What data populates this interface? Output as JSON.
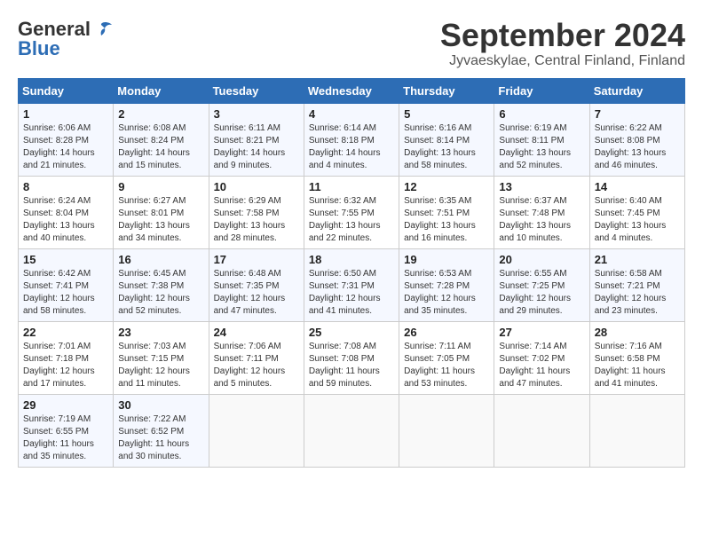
{
  "header": {
    "logo_general": "General",
    "logo_blue": "Blue",
    "title": "September 2024",
    "subtitle": "Jyvaeskylae, Central Finland, Finland"
  },
  "weekdays": [
    "Sunday",
    "Monday",
    "Tuesday",
    "Wednesday",
    "Thursday",
    "Friday",
    "Saturday"
  ],
  "weeks": [
    [
      {
        "day": "1",
        "sunrise": "Sunrise: 6:06 AM",
        "sunset": "Sunset: 8:28 PM",
        "daylight": "Daylight: 14 hours and 21 minutes."
      },
      {
        "day": "2",
        "sunrise": "Sunrise: 6:08 AM",
        "sunset": "Sunset: 8:24 PM",
        "daylight": "Daylight: 14 hours and 15 minutes."
      },
      {
        "day": "3",
        "sunrise": "Sunrise: 6:11 AM",
        "sunset": "Sunset: 8:21 PM",
        "daylight": "Daylight: 14 hours and 9 minutes."
      },
      {
        "day": "4",
        "sunrise": "Sunrise: 6:14 AM",
        "sunset": "Sunset: 8:18 PM",
        "daylight": "Daylight: 14 hours and 4 minutes."
      },
      {
        "day": "5",
        "sunrise": "Sunrise: 6:16 AM",
        "sunset": "Sunset: 8:14 PM",
        "daylight": "Daylight: 13 hours and 58 minutes."
      },
      {
        "day": "6",
        "sunrise": "Sunrise: 6:19 AM",
        "sunset": "Sunset: 8:11 PM",
        "daylight": "Daylight: 13 hours and 52 minutes."
      },
      {
        "day": "7",
        "sunrise": "Sunrise: 6:22 AM",
        "sunset": "Sunset: 8:08 PM",
        "daylight": "Daylight: 13 hours and 46 minutes."
      }
    ],
    [
      {
        "day": "8",
        "sunrise": "Sunrise: 6:24 AM",
        "sunset": "Sunset: 8:04 PM",
        "daylight": "Daylight: 13 hours and 40 minutes."
      },
      {
        "day": "9",
        "sunrise": "Sunrise: 6:27 AM",
        "sunset": "Sunset: 8:01 PM",
        "daylight": "Daylight: 13 hours and 34 minutes."
      },
      {
        "day": "10",
        "sunrise": "Sunrise: 6:29 AM",
        "sunset": "Sunset: 7:58 PM",
        "daylight": "Daylight: 13 hours and 28 minutes."
      },
      {
        "day": "11",
        "sunrise": "Sunrise: 6:32 AM",
        "sunset": "Sunset: 7:55 PM",
        "daylight": "Daylight: 13 hours and 22 minutes."
      },
      {
        "day": "12",
        "sunrise": "Sunrise: 6:35 AM",
        "sunset": "Sunset: 7:51 PM",
        "daylight": "Daylight: 13 hours and 16 minutes."
      },
      {
        "day": "13",
        "sunrise": "Sunrise: 6:37 AM",
        "sunset": "Sunset: 7:48 PM",
        "daylight": "Daylight: 13 hours and 10 minutes."
      },
      {
        "day": "14",
        "sunrise": "Sunrise: 6:40 AM",
        "sunset": "Sunset: 7:45 PM",
        "daylight": "Daylight: 13 hours and 4 minutes."
      }
    ],
    [
      {
        "day": "15",
        "sunrise": "Sunrise: 6:42 AM",
        "sunset": "Sunset: 7:41 PM",
        "daylight": "Daylight: 12 hours and 58 minutes."
      },
      {
        "day": "16",
        "sunrise": "Sunrise: 6:45 AM",
        "sunset": "Sunset: 7:38 PM",
        "daylight": "Daylight: 12 hours and 52 minutes."
      },
      {
        "day": "17",
        "sunrise": "Sunrise: 6:48 AM",
        "sunset": "Sunset: 7:35 PM",
        "daylight": "Daylight: 12 hours and 47 minutes."
      },
      {
        "day": "18",
        "sunrise": "Sunrise: 6:50 AM",
        "sunset": "Sunset: 7:31 PM",
        "daylight": "Daylight: 12 hours and 41 minutes."
      },
      {
        "day": "19",
        "sunrise": "Sunrise: 6:53 AM",
        "sunset": "Sunset: 7:28 PM",
        "daylight": "Daylight: 12 hours and 35 minutes."
      },
      {
        "day": "20",
        "sunrise": "Sunrise: 6:55 AM",
        "sunset": "Sunset: 7:25 PM",
        "daylight": "Daylight: 12 hours and 29 minutes."
      },
      {
        "day": "21",
        "sunrise": "Sunrise: 6:58 AM",
        "sunset": "Sunset: 7:21 PM",
        "daylight": "Daylight: 12 hours and 23 minutes."
      }
    ],
    [
      {
        "day": "22",
        "sunrise": "Sunrise: 7:01 AM",
        "sunset": "Sunset: 7:18 PM",
        "daylight": "Daylight: 12 hours and 17 minutes."
      },
      {
        "day": "23",
        "sunrise": "Sunrise: 7:03 AM",
        "sunset": "Sunset: 7:15 PM",
        "daylight": "Daylight: 12 hours and 11 minutes."
      },
      {
        "day": "24",
        "sunrise": "Sunrise: 7:06 AM",
        "sunset": "Sunset: 7:11 PM",
        "daylight": "Daylight: 12 hours and 5 minutes."
      },
      {
        "day": "25",
        "sunrise": "Sunrise: 7:08 AM",
        "sunset": "Sunset: 7:08 PM",
        "daylight": "Daylight: 11 hours and 59 minutes."
      },
      {
        "day": "26",
        "sunrise": "Sunrise: 7:11 AM",
        "sunset": "Sunset: 7:05 PM",
        "daylight": "Daylight: 11 hours and 53 minutes."
      },
      {
        "day": "27",
        "sunrise": "Sunrise: 7:14 AM",
        "sunset": "Sunset: 7:02 PM",
        "daylight": "Daylight: 11 hours and 47 minutes."
      },
      {
        "day": "28",
        "sunrise": "Sunrise: 7:16 AM",
        "sunset": "Sunset: 6:58 PM",
        "daylight": "Daylight: 11 hours and 41 minutes."
      }
    ],
    [
      {
        "day": "29",
        "sunrise": "Sunrise: 7:19 AM",
        "sunset": "Sunset: 6:55 PM",
        "daylight": "Daylight: 11 hours and 35 minutes."
      },
      {
        "day": "30",
        "sunrise": "Sunrise: 7:22 AM",
        "sunset": "Sunset: 6:52 PM",
        "daylight": "Daylight: 11 hours and 30 minutes."
      },
      null,
      null,
      null,
      null,
      null
    ]
  ]
}
